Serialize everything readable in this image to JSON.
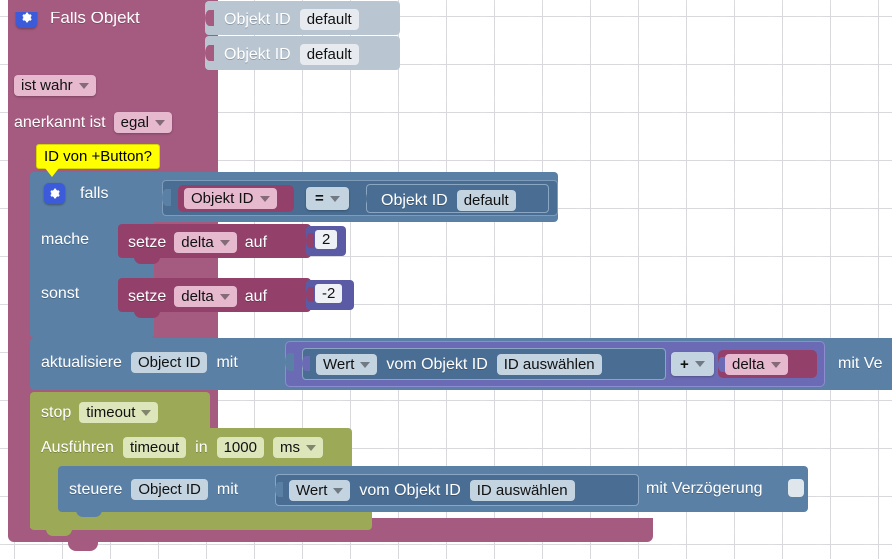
{
  "workspace": {
    "type": "blockly-workspace",
    "language": "de",
    "grid": {
      "spacing": 48,
      "color": "#dcdce0"
    },
    "background": "#ffffff"
  },
  "tooltip": {
    "text": "ID von +Button?",
    "color": "#ffff00"
  },
  "colors": {
    "control_rose": "#a55b80",
    "control_blue": "#5b80a5",
    "timing_olive": "#9caa58",
    "math_purple": "#6b6bb5",
    "number_blue": "#5b5ba5",
    "disabled_grey": "#b9c6d1",
    "field_rose": "#e6b9cf",
    "field_blue": "#c3d3e0",
    "field_olive": "#dde5bb",
    "mutator_icon": "#3b5bdb"
  },
  "blocks": {
    "on_state": {
      "icon": "gear-icon",
      "title": "Falls Objekt",
      "conditions": [
        {
          "label": "ist wahr",
          "kind": "dropdown"
        },
        {
          "prefix": "anerkannt ist",
          "value": "egal",
          "kind": "dropdown"
        }
      ],
      "detached_inputs": [
        {
          "label": "Objekt ID",
          "value": "default",
          "disabled": true
        },
        {
          "label": "Objekt ID",
          "value": "default",
          "disabled": true
        }
      ]
    },
    "if_block": {
      "icon": "gear-icon",
      "if_label": "falls",
      "do_label": "mache",
      "else_label": "sonst",
      "condition": {
        "left": {
          "label": "Objekt ID",
          "kind": "dropdown"
        },
        "operator": "=",
        "right": {
          "label": "Objekt ID",
          "value": "default"
        }
      },
      "do_statement": {
        "set_label": "setze",
        "variable": "delta",
        "to_label": "auf",
        "number": "2"
      },
      "else_statement": {
        "set_label": "setze",
        "variable": "delta",
        "to_label": "auf",
        "number": "-2"
      }
    },
    "update_block": {
      "verb": "aktualisiere",
      "object_field": "Object ID",
      "with_label": "mit",
      "value_expression": {
        "kind_field": "Wert",
        "from_label": "vom Objekt ID",
        "object_field": "ID auswählen",
        "operator": "+",
        "operand": "delta"
      },
      "trailing_label": "mit Ve"
    },
    "stop_timeout": {
      "verb": "stop",
      "target": "timeout"
    },
    "run_timeout": {
      "verb": "Ausführen",
      "target": "timeout",
      "in_label": "in",
      "delay": "1000",
      "unit": "ms"
    },
    "control_block": {
      "verb": "steuere",
      "object_field": "Object ID",
      "with_label": "mit",
      "value_expression": {
        "kind_field": "Wert",
        "from_label": "vom Objekt ID",
        "object_field": "ID auswählen"
      },
      "delay_label": "mit Verzögerung",
      "delay_checkbox": false
    }
  }
}
